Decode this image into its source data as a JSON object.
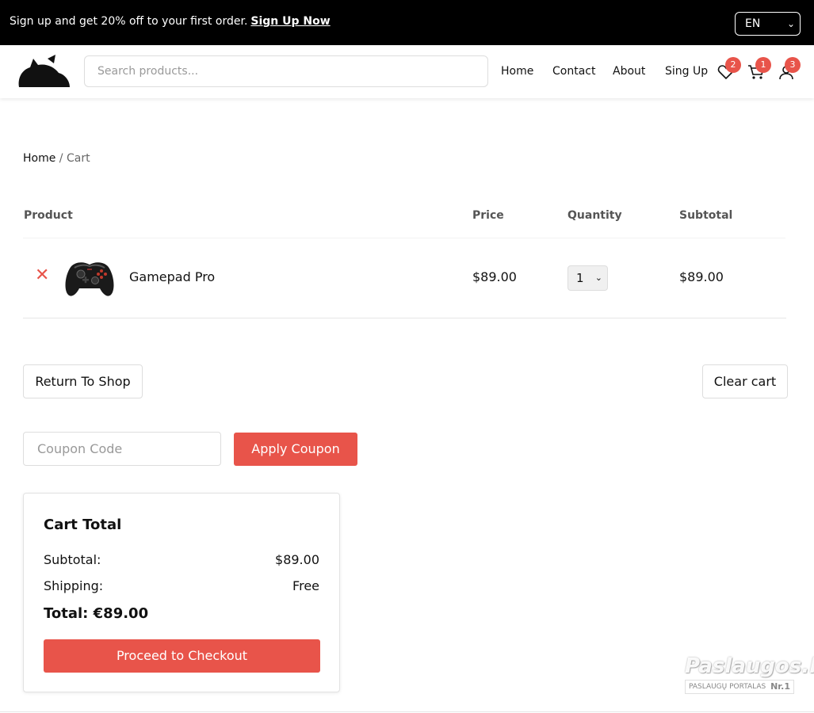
{
  "topbar": {
    "promo_text": "Sign up and get 20% off to your first order.",
    "promo_link": "Sign Up Now",
    "language": "EN"
  },
  "header": {
    "search_placeholder": "Search products...",
    "nav": [
      "Home",
      "Contact",
      "About",
      "Sing Up"
    ],
    "badges": {
      "wishlist": "2",
      "cart": "1",
      "account": "3"
    }
  },
  "breadcrumb": {
    "home": "Home",
    "separator": "/",
    "current": "Cart"
  },
  "cart": {
    "columns": {
      "product": "Product",
      "price": "Price",
      "quantity": "Quantity",
      "subtotal": "Subtotal"
    },
    "items": [
      {
        "name": "Gamepad Pro",
        "price": "$89.00",
        "quantity": "1",
        "subtotal": "$89.00"
      }
    ]
  },
  "actions": {
    "return_to_shop": "Return To Shop",
    "clear_cart": "Clear cart",
    "coupon_placeholder": "Coupon Code",
    "apply_coupon": "Apply Coupon"
  },
  "cart_total": {
    "title": "Cart Total",
    "subtotal_label": "Subtotal:",
    "subtotal_value": "$89.00",
    "shipping_label": "Shipping:",
    "shipping_value": "Free",
    "total": "Total: €89.00",
    "checkout": "Proceed to Checkout"
  },
  "watermark": {
    "brand": "Paslaugos.lt",
    "tagline": "PASLAUGŲ PORTALAS",
    "rank": "Nr.1"
  },
  "icons": {
    "wishlist": "heart-icon",
    "cart": "cart-icon",
    "account": "user-icon",
    "remove": "close-icon"
  },
  "colors": {
    "accent": "#e8544a",
    "topbar": "#000000"
  }
}
